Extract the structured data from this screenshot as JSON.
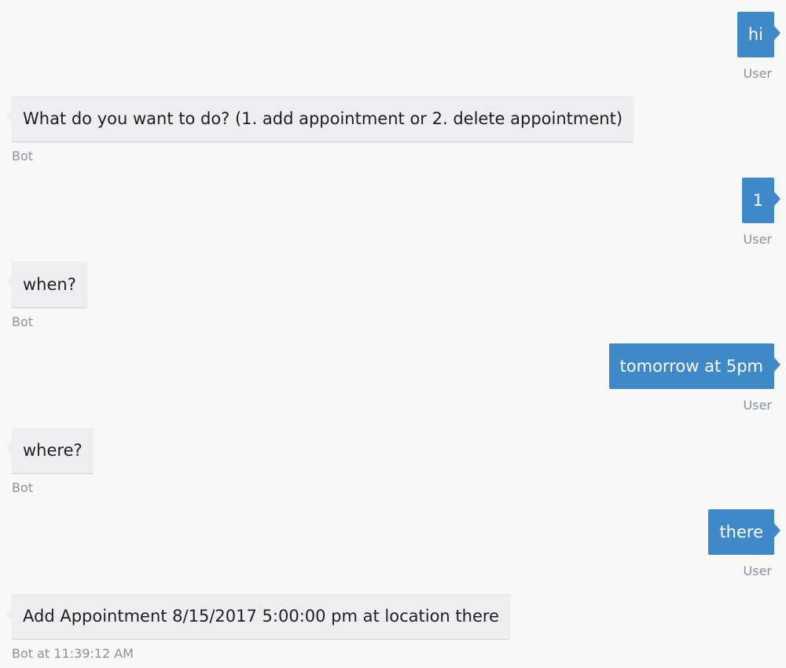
{
  "messages": [
    {
      "from": "user",
      "text": "hi",
      "sender": "User"
    },
    {
      "from": "bot",
      "text": "What do you want to do? (1. add appointment or 2. delete appointment)",
      "sender": "Bot"
    },
    {
      "from": "user",
      "text": "1",
      "sender": "User"
    },
    {
      "from": "bot",
      "text": "when?",
      "sender": "Bot"
    },
    {
      "from": "user",
      "text": "tomorrow at 5pm",
      "sender": "User"
    },
    {
      "from": "bot",
      "text": "where?",
      "sender": "Bot"
    },
    {
      "from": "user",
      "text": "there",
      "sender": "User"
    },
    {
      "from": "bot",
      "text": "Add Appointment 8/15/2017 5:00:00 pm at location there",
      "sender": "Bot at 11:39:12 AM"
    }
  ],
  "colors": {
    "background": "#f8f8f8",
    "user_bubble": "#3f89c8",
    "bot_bubble": "#eeeef0",
    "sender_text": "#8a929a"
  }
}
